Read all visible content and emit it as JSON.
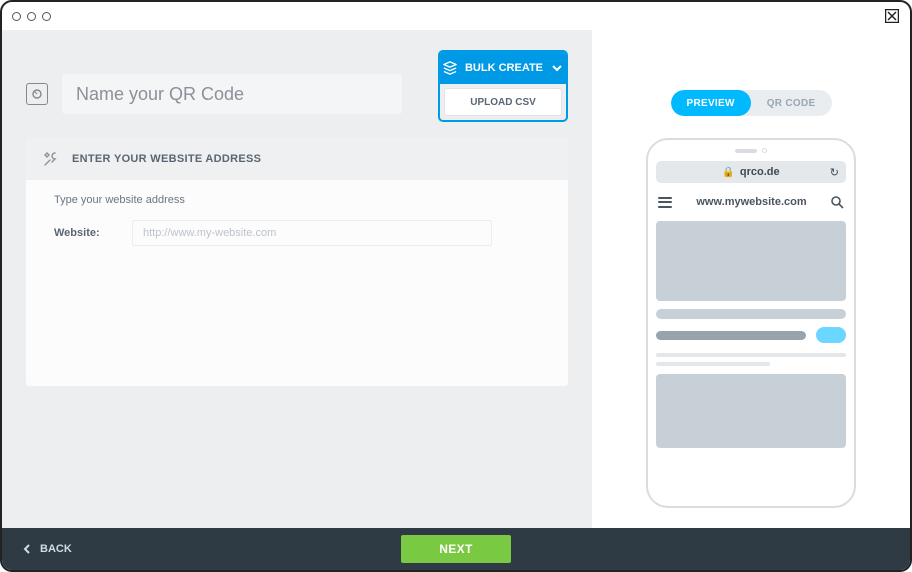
{
  "name_input": {
    "placeholder": "Name your QR Code"
  },
  "bulk": {
    "label": "BULK CREATE",
    "items": [
      "UPLOAD CSV"
    ]
  },
  "panel": {
    "title": "ENTER YOUR WEBSITE ADDRESS",
    "hint": "Type your website address",
    "field_label": "Website:",
    "url_placeholder": "http://www.my-website.com"
  },
  "toggle": {
    "preview": "PREVIEW",
    "qrcode": "QR CODE"
  },
  "phone": {
    "domain": "qrco.de",
    "site_url": "www.mywebsite.com"
  },
  "footer": {
    "back": "BACK",
    "next": "NEXT"
  }
}
